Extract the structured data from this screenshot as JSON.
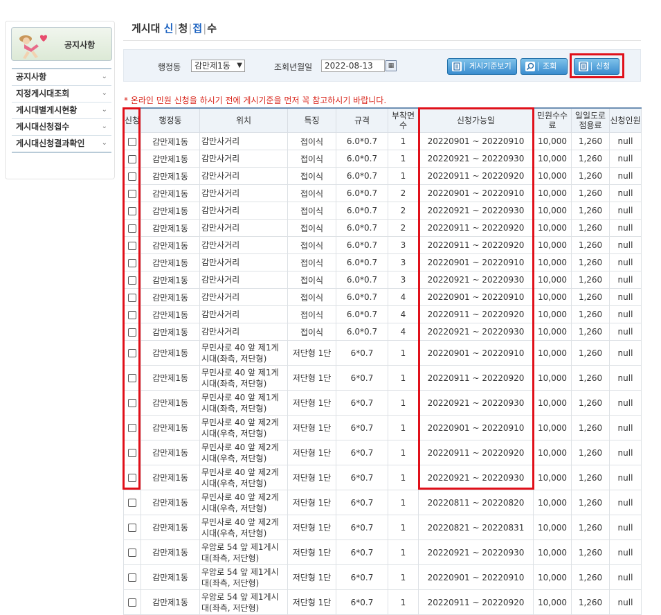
{
  "sidebar": {
    "title": "공지사항",
    "items": [
      {
        "label": "공지사항"
      },
      {
        "label": "지정게시대조회"
      },
      {
        "label": "게시대별게시현황"
      },
      {
        "label": "게시대신청접수"
      },
      {
        "label": "게시대신청결과확인"
      }
    ]
  },
  "page_title": {
    "part1": "게시대",
    "part2": "신",
    "part3": "청",
    "part4": "접",
    "part5": "수"
  },
  "search": {
    "dong_label": "행정동",
    "dong_value": "감만제1동",
    "date_label": "조회년월일",
    "date_value": "2022-08-13",
    "calendar_icon": "calendar-icon",
    "criteria_button": "게시기준보기",
    "search_button": "조회",
    "apply_button": "신청"
  },
  "notice": "* 온라인 민원 신청을 하시기 전에 게시기준을 먼저 꼭 참고하시기 바랍니다.",
  "table": {
    "headers": {
      "apply": "신청",
      "dong": "행정동",
      "location": "위치",
      "feature": "특징",
      "size": "규격",
      "count": "부착면수",
      "period": "신청가능일",
      "fee": "민원수수료",
      "road_fee": "일일도로점용료",
      "applicants": "신청인원"
    },
    "rows": [
      {
        "dong": "감만제1동",
        "location": "감만사거리",
        "feature": "접이식",
        "size": "6.0*0.7",
        "count": "1",
        "period": "20220901 ~ 20220910",
        "fee": "10,000",
        "road_fee": "1,260",
        "applicants": "null"
      },
      {
        "dong": "감만제1동",
        "location": "감만사거리",
        "feature": "접이식",
        "size": "6.0*0.7",
        "count": "1",
        "period": "20220921 ~ 20220930",
        "fee": "10,000",
        "road_fee": "1,260",
        "applicants": "null"
      },
      {
        "dong": "감만제1동",
        "location": "감만사거리",
        "feature": "접이식",
        "size": "6.0*0.7",
        "count": "1",
        "period": "20220911 ~ 20220920",
        "fee": "10,000",
        "road_fee": "1,260",
        "applicants": "null"
      },
      {
        "dong": "감만제1동",
        "location": "감만사거리",
        "feature": "접이식",
        "size": "6.0*0.7",
        "count": "2",
        "period": "20220901 ~ 20220910",
        "fee": "10,000",
        "road_fee": "1,260",
        "applicants": "null"
      },
      {
        "dong": "감만제1동",
        "location": "감만사거리",
        "feature": "접이식",
        "size": "6.0*0.7",
        "count": "2",
        "period": "20220921 ~ 20220930",
        "fee": "10,000",
        "road_fee": "1,260",
        "applicants": "null"
      },
      {
        "dong": "감만제1동",
        "location": "감만사거리",
        "feature": "접이식",
        "size": "6.0*0.7",
        "count": "2",
        "period": "20220911 ~ 20220920",
        "fee": "10,000",
        "road_fee": "1,260",
        "applicants": "null"
      },
      {
        "dong": "감만제1동",
        "location": "감만사거리",
        "feature": "접이식",
        "size": "6.0*0.7",
        "count": "3",
        "period": "20220911 ~ 20220920",
        "fee": "10,000",
        "road_fee": "1,260",
        "applicants": "null"
      },
      {
        "dong": "감만제1동",
        "location": "감만사거리",
        "feature": "접이식",
        "size": "6.0*0.7",
        "count": "3",
        "period": "20220901 ~ 20220910",
        "fee": "10,000",
        "road_fee": "1,260",
        "applicants": "null"
      },
      {
        "dong": "감만제1동",
        "location": "감만사거리",
        "feature": "접이식",
        "size": "6.0*0.7",
        "count": "3",
        "period": "20220921 ~ 20220930",
        "fee": "10,000",
        "road_fee": "1,260",
        "applicants": "null"
      },
      {
        "dong": "감만제1동",
        "location": "감만사거리",
        "feature": "접이식",
        "size": "6.0*0.7",
        "count": "4",
        "period": "20220901 ~ 20220910",
        "fee": "10,000",
        "road_fee": "1,260",
        "applicants": "null"
      },
      {
        "dong": "감만제1동",
        "location": "감만사거리",
        "feature": "접이식",
        "size": "6.0*0.7",
        "count": "4",
        "period": "20220911 ~ 20220920",
        "fee": "10,000",
        "road_fee": "1,260",
        "applicants": "null"
      },
      {
        "dong": "감만제1동",
        "location": "감만사거리",
        "feature": "접이식",
        "size": "6.0*0.7",
        "count": "4",
        "period": "20220921 ~ 20220930",
        "fee": "10,000",
        "road_fee": "1,260",
        "applicants": "null"
      },
      {
        "dong": "감만제1동",
        "location": "무민사로 40 앞 제1게시대(좌측, 저단형)",
        "feature": "저단형 1단",
        "size": "6*0.7",
        "count": "1",
        "period": "20220901 ~ 20220910",
        "fee": "10,000",
        "road_fee": "1,260",
        "applicants": "null"
      },
      {
        "dong": "감만제1동",
        "location": "무민사로 40 앞 제1게시대(좌측, 저단형)",
        "feature": "저단형 1단",
        "size": "6*0.7",
        "count": "1",
        "period": "20220911 ~ 20220920",
        "fee": "10,000",
        "road_fee": "1,260",
        "applicants": "null"
      },
      {
        "dong": "감만제1동",
        "location": "무민사로 40 앞 제1게시대(좌측, 저단형)",
        "feature": "저단형 1단",
        "size": "6*0.7",
        "count": "1",
        "period": "20220921 ~ 20220930",
        "fee": "10,000",
        "road_fee": "1,260",
        "applicants": "null"
      },
      {
        "dong": "감만제1동",
        "location": "무민사로 40 앞 제2게시대(우측, 저단형)",
        "feature": "저단형 1단",
        "size": "6*0.7",
        "count": "1",
        "period": "20220901 ~ 20220910",
        "fee": "10,000",
        "road_fee": "1,260",
        "applicants": "null"
      },
      {
        "dong": "감만제1동",
        "location": "무민사로 40 앞 제2게시대(우측, 저단형)",
        "feature": "저단형 1단",
        "size": "6*0.7",
        "count": "1",
        "period": "20220911 ~ 20220920",
        "fee": "10,000",
        "road_fee": "1,260",
        "applicants": "null"
      },
      {
        "dong": "감만제1동",
        "location": "무민사로 40 앞 제2게시대(우측, 저단형)",
        "feature": "저단형 1단",
        "size": "6*0.7",
        "count": "1",
        "period": "20220921 ~ 20220930",
        "fee": "10,000",
        "road_fee": "1,260",
        "applicants": "null"
      },
      {
        "dong": "감만제1동",
        "location": "무민사로 40 앞 제2게시대(우측, 저단형)",
        "feature": "저단형 1단",
        "size": "6*0.7",
        "count": "1",
        "period": "20220811 ~ 20220820",
        "fee": "10,000",
        "road_fee": "1,260",
        "applicants": "null"
      },
      {
        "dong": "감만제1동",
        "location": "무민사로 40 앞 제2게시대(우측, 저단형)",
        "feature": "저단형 1단",
        "size": "6*0.7",
        "count": "1",
        "period": "20220821 ~ 20220831",
        "fee": "10,000",
        "road_fee": "1,260",
        "applicants": "null"
      },
      {
        "dong": "감만제1동",
        "location": "우암로 54 앞 제1게시대(좌측, 저단형)",
        "feature": "저단형 1단",
        "size": "6*0.7",
        "count": "1",
        "period": "20220921 ~ 20220930",
        "fee": "10,000",
        "road_fee": "1,260",
        "applicants": "null"
      },
      {
        "dong": "감만제1동",
        "location": "우암로 54 앞 제1게시대(좌측, 저단형)",
        "feature": "저단형 1단",
        "size": "6*0.7",
        "count": "1",
        "period": "20220901 ~ 20220910",
        "fee": "10,000",
        "road_fee": "1,260",
        "applicants": "null"
      },
      {
        "dong": "감만제1동",
        "location": "우암로 54 앞 제1게시대(좌측, 저단형)",
        "feature": "저단형 1단",
        "size": "6*0.7",
        "count": "1",
        "period": "20220911 ~ 20220920",
        "fee": "10,000",
        "road_fee": "1,260",
        "applicants": "null"
      }
    ]
  },
  "colors": {
    "accent": "#1b62c0",
    "highlight_box": "#e0101a",
    "notice": "#d9261c",
    "button": "#3a8ccf"
  }
}
